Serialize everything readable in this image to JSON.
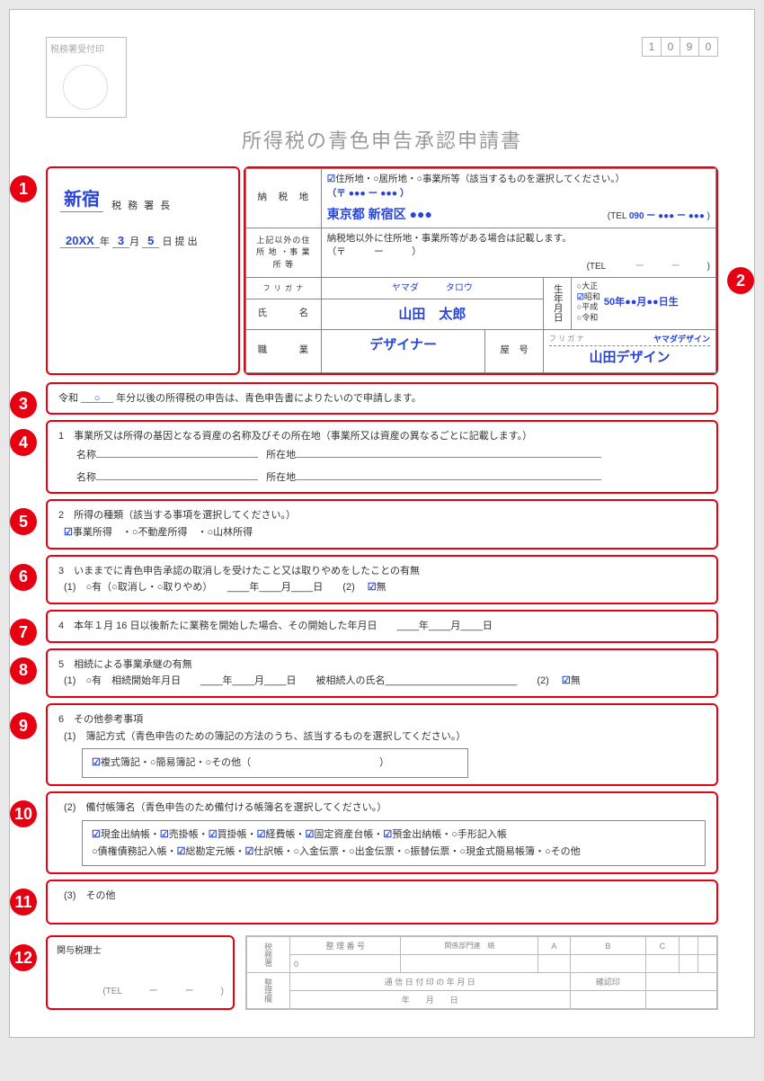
{
  "header": {
    "stamp_label": "税務署受付印",
    "code": [
      "1",
      "0",
      "9",
      "0"
    ],
    "title": "所得税の青色申告承認申請書"
  },
  "upper_left": {
    "office": "新宿",
    "office_suffix": "税 務 署 長",
    "year": "20XX",
    "month": "3",
    "day": "5",
    "submit_suffix": "日 提 出"
  },
  "upper_right": {
    "block1_label": "納　税　地",
    "addr_opts": "住所地・○居所地・○事業所等（該当するものを選択してください。）",
    "zip": "（〒 ●●● ー ●●● ）",
    "address": "東京都 新宿区 ●●●",
    "tel_label": "(TEL",
    "tel": "090 ー ●●● ー ●●●",
    "block2_label": "上記以外の住 所 地 ・事 業 所 等",
    "block2_note": "納税地以外に住所地・事業所等がある場合は記載します。",
    "block2_zip": "（〒　　　ー　　　）",
    "tel_blank": "　　　ー　　　ー　　　",
    "furigana_label": "フ リ ガ ナ",
    "furigana": "ヤマダ　　　タロウ",
    "name_label": "氏　　　名",
    "name": "山田　太郎",
    "dob_label": "生年月日",
    "era_opts": [
      "○大正",
      "昭和",
      "○平成",
      "○令和"
    ],
    "dob": "50年●●月●●日生",
    "job_label": "職　　　業",
    "job": "デザイナー",
    "yago_label": "屋　号",
    "yago_furigana_label": "フ リ ガ ナ",
    "yago_furigana": "ヤマダデザイン",
    "yago": "山田デザイン"
  },
  "s3": {
    "text_a": "令和 ",
    "text_b": " 年分以後の所得税の申告は、青色申告書によりたいので申請します。",
    "circle": "○"
  },
  "s4": {
    "heading": "1　事業所又は所得の基因となる資産の名称及びその所在地（事業所又は資産の異なるごとに記載します。）",
    "name_label": "名称",
    "loc_label": "所在地"
  },
  "s5": {
    "heading": "2　所得の種類（該当する事項を選択してください。）",
    "opts": "事業所得　・○不動産所得　・○山林所得"
  },
  "s6": {
    "heading": "3　いままでに青色申告承認の取消しを受けたこと又は取りやめをしたことの有無",
    "row": "(1)　○有（○取消し・○取りやめ）　　____年____月____日　　(2)　",
    "mu": "無"
  },
  "s7": {
    "heading": "4　本年１月 16 日以後新たに業務を開始した場合、その開始した年月日　　____年____月____日"
  },
  "s8": {
    "heading": "5　相続による事業承継の有無",
    "row": "(1)　○有　相続開始年月日　　____年____月____日　　被相続人の氏名________________________　　(2)　",
    "mu": "無"
  },
  "s9_heading": "6　その他参考事項",
  "s9": {
    "sub": "(1)　簿記方式（青色申告のための簿記の方法のうち、該当するものを選択してください。）",
    "opts": "複式簿記・○簡易簿記・○その他（　　　　　　　　　　　　　）"
  },
  "s10": {
    "sub": "(2)　備付帳簿名（青色申告のため備付ける帳簿名を選択してください。）",
    "row1_items": [
      "現金出納帳",
      "売掛帳",
      "買掛帳",
      "経費帳",
      "固定資産台帳",
      "預金出納帳"
    ],
    "row1_unchecked": "・○手形記入帳",
    "row2a": "○債権債務記入帳・",
    "row2_checked": [
      "総勘定元帳",
      "仕訳帳"
    ],
    "row2b": "・○入金伝票・○出金伝票・○振替伝票・○現金式簡易帳簿・○その他"
  },
  "s11": {
    "sub": "(3)　その他"
  },
  "s12": {
    "label": "関与税理士",
    "tel": "(TEL　　　ー　　　ー　　　)"
  },
  "office_use": {
    "vlabel1": "税務署",
    "vlabel2": "整理欄",
    "r1": [
      "整 理 番 号",
      "関係部門連　絡",
      "A",
      "B",
      "C",
      "",
      ""
    ],
    "r2_pre": "0",
    "r3": [
      "通 信 日 付 印 の 年 月 日",
      "確認印",
      "",
      ""
    ],
    "r4": "年　　月　　日"
  }
}
